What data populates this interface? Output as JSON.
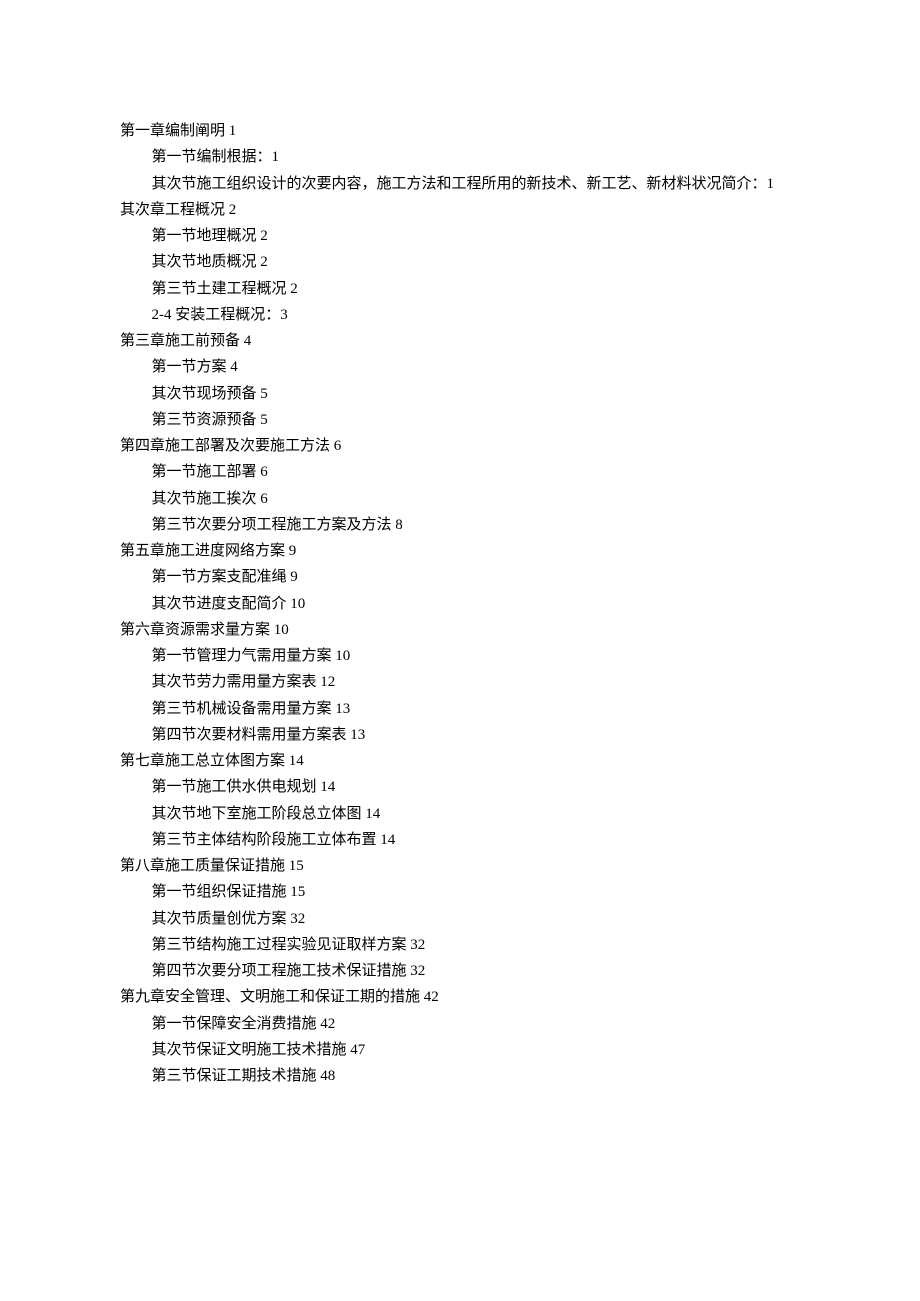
{
  "toc": [
    {
      "level": 0,
      "text": "第一章编制阐明 1"
    },
    {
      "level": 1,
      "text": "第一节编制根据：1"
    },
    {
      "level": 1,
      "text": "其次节施工组织设计的次要内容，施工方法和工程所用的新技术、新工艺、新材料状况简介：1",
      "wrap": true
    },
    {
      "level": 0,
      "text": "其次章工程概况 2"
    },
    {
      "level": 1,
      "text": "第一节地理概况 2"
    },
    {
      "level": 1,
      "text": "其次节地质概况 2"
    },
    {
      "level": 1,
      "text": "第三节土建工程概况 2"
    },
    {
      "level": 1,
      "text": "2-4 安装工程概况：3"
    },
    {
      "level": 0,
      "text": "第三章施工前预备 4"
    },
    {
      "level": 1,
      "text": "第一节方案 4"
    },
    {
      "level": 1,
      "text": "其次节现场预备 5"
    },
    {
      "level": 1,
      "text": "第三节资源预备 5"
    },
    {
      "level": 0,
      "text": "第四章施工部署及次要施工方法 6"
    },
    {
      "level": 1,
      "text": "第一节施工部署 6"
    },
    {
      "level": 1,
      "text": "其次节施工挨次 6"
    },
    {
      "level": 1,
      "text": "第三节次要分项工程施工方案及方法 8"
    },
    {
      "level": 0,
      "text": "第五章施工进度网络方案 9"
    },
    {
      "level": 1,
      "text": "第一节方案支配准绳 9"
    },
    {
      "level": 1,
      "text": "其次节进度支配简介 10"
    },
    {
      "level": 0,
      "text": "第六章资源需求量方案 10"
    },
    {
      "level": 1,
      "text": "第一节管理力气需用量方案 10"
    },
    {
      "level": 1,
      "text": "其次节劳力需用量方案表 12"
    },
    {
      "level": 1,
      "text": "第三节机械设备需用量方案 13"
    },
    {
      "level": 1,
      "text": "第四节次要材料需用量方案表 13"
    },
    {
      "level": 0,
      "text": "第七章施工总立体图方案 14"
    },
    {
      "level": 1,
      "text": "第一节施工供水供电规划 14"
    },
    {
      "level": 1,
      "text": "其次节地下室施工阶段总立体图 14"
    },
    {
      "level": 1,
      "text": "第三节主体结构阶段施工立体布置 14"
    },
    {
      "level": 0,
      "text": "第八章施工质量保证措施 15"
    },
    {
      "level": 1,
      "text": "第一节组织保证措施 15"
    },
    {
      "level": 1,
      "text": "其次节质量创优方案 32"
    },
    {
      "level": 1,
      "text": "第三节结构施工过程实验见证取样方案 32"
    },
    {
      "level": 1,
      "text": "第四节次要分项工程施工技术保证措施 32"
    },
    {
      "level": 0,
      "text": "第九章安全管理、文明施工和保证工期的措施 42"
    },
    {
      "level": 1,
      "text": "第一节保障安全消费措施 42"
    },
    {
      "level": 1,
      "text": "其次节保证文明施工技术措施 47"
    },
    {
      "level": 1,
      "text": "第三节保证工期技术措施 48"
    }
  ]
}
